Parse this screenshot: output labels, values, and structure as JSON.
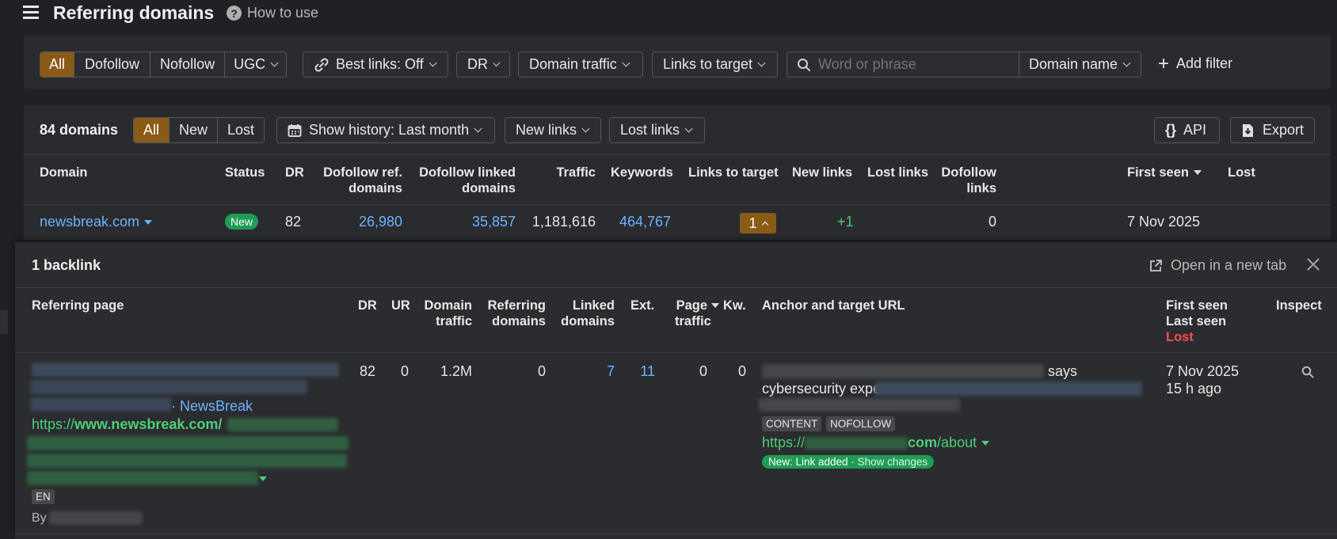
{
  "header": {
    "title": "Referring domains",
    "how_to_use": "How to use"
  },
  "filters": {
    "link_types": [
      "All",
      "Dofollow",
      "Nofollow",
      "UGC"
    ],
    "best_links": "Best links: Off",
    "dr": "DR",
    "domain_traffic": "Domain traffic",
    "links_to_target": "Links to target",
    "search_placeholder": "Word or phrase",
    "search_scope": "Domain name",
    "add_filter": "Add filter"
  },
  "results": {
    "count_label": "84 domains",
    "tabs": [
      "All",
      "New",
      "Lost"
    ],
    "history": "Show history: Last month",
    "new_links": "New links",
    "lost_links": "Lost links",
    "api": "API",
    "export": "Export"
  },
  "table": {
    "columns": {
      "domain": "Domain",
      "status": "Status",
      "dr": "DR",
      "dofollow_ref_1": "Dofollow ref.",
      "dofollow_ref_2": "domains",
      "dofollow_linked_1": "Dofollow linked",
      "dofollow_linked_2": "domains",
      "traffic": "Traffic",
      "keywords": "Keywords",
      "links_to_target": "Links to target",
      "new_links": "New links",
      "lost_links": "Lost links",
      "dofollow_links_1": "Dofollow",
      "dofollow_links_2": "links",
      "first_seen": "First seen",
      "lost": "Lost"
    },
    "row": {
      "domain": "newsbreak.com",
      "status": "New",
      "dr": "82",
      "dofollow_ref_domains": "26,980",
      "dofollow_linked_domains": "35,857",
      "traffic": "1,181,616",
      "keywords": "464,767",
      "links_to_target": "1",
      "new_links": "+1",
      "lost_links": "",
      "dofollow_links": "0",
      "first_seen": "7 Nov 2025",
      "lost": ""
    }
  },
  "backlinks": {
    "title": "1 backlink",
    "open_new_tab": "Open in a new tab",
    "columns": {
      "referring_page": "Referring page",
      "dr": "DR",
      "ur": "UR",
      "domain_traffic_1": "Domain",
      "domain_traffic_2": "traffic",
      "referring_domains_1": "Referring",
      "referring_domains_2": "domains",
      "linked_domains_1": "Linked",
      "linked_domains_2": "domains",
      "ext": "Ext.",
      "page_traffic_1": "Page",
      "page_traffic_2": "traffic",
      "kw": "Kw.",
      "anchor": "Anchor and target URL",
      "first_seen": "First seen",
      "last_seen": "Last seen",
      "lost": "Lost",
      "inspect": "Inspect"
    },
    "row": {
      "site_name": "NewsBreak",
      "url_prefix": "https://",
      "url_domain": "www.newsbreak.com/",
      "lang": "EN",
      "by": "By",
      "dr": "82",
      "ur": "0",
      "domain_traffic": "1.2M",
      "referring_domains": "0",
      "linked_domains": "7",
      "ext": "11",
      "page_traffic": "0",
      "kw": "0",
      "anchor_says": "says",
      "anchor_text": "cybersecurity expert",
      "tag_content": "CONTENT",
      "tag_nofollow": "NOFOLLOW",
      "target_prefix": "https://",
      "target_domain": "com",
      "target_path": "/about",
      "change_badge": "New: Link added · ",
      "show_changes": "Show changes",
      "first_seen": "7 Nov 2025",
      "last_seen": "15 h ago"
    }
  },
  "colors": {
    "accent": "#8a5a17",
    "link": "#6cb2ff",
    "green": "#4ccf78",
    "lost_red": "#ff4d4d"
  }
}
